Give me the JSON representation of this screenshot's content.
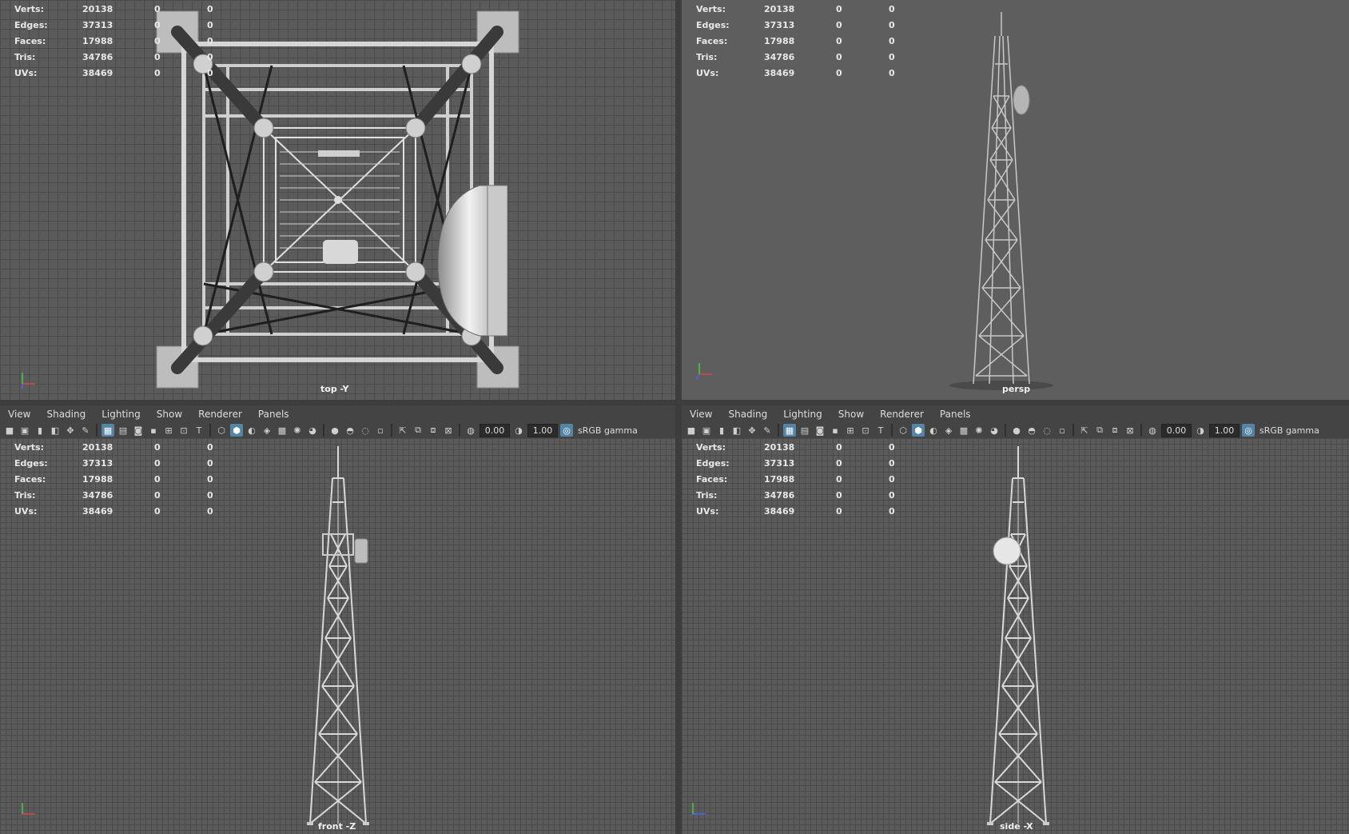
{
  "hud": [
    {
      "label": "Verts:",
      "value": "20138",
      "c1": "0",
      "c2": "0"
    },
    {
      "label": "Edges:",
      "value": "37313",
      "c1": "0",
      "c2": "0"
    },
    {
      "label": "Faces:",
      "value": "17988",
      "c1": "0",
      "c2": "0"
    },
    {
      "label": "Tris:",
      "value": "34786",
      "c1": "0",
      "c2": "0"
    },
    {
      "label": "UVs:",
      "value": "38469",
      "c1": "0",
      "c2": "0"
    }
  ],
  "viewports": {
    "top": {
      "label": "top -Y"
    },
    "persp": {
      "label": "persp"
    },
    "front": {
      "label": "front -Z"
    },
    "side": {
      "label": "side -X"
    }
  },
  "panel_menu": [
    "View",
    "Shading",
    "Lighting",
    "Show",
    "Renderer",
    "Panels"
  ],
  "panel_fields": {
    "exposure": "0.00",
    "gamma_value": "1.00",
    "color_space": "sRGB gamma"
  },
  "icons": [
    "camera-icon",
    "bookmark-icon",
    "grid-icon",
    "wireframe-icon",
    "smooth-shade-icon",
    "textured-icon",
    "light-icon",
    "isolate-icon",
    "xray-icon",
    "exposure-icon",
    "gamma-icon",
    "color-management-icon"
  ]
}
